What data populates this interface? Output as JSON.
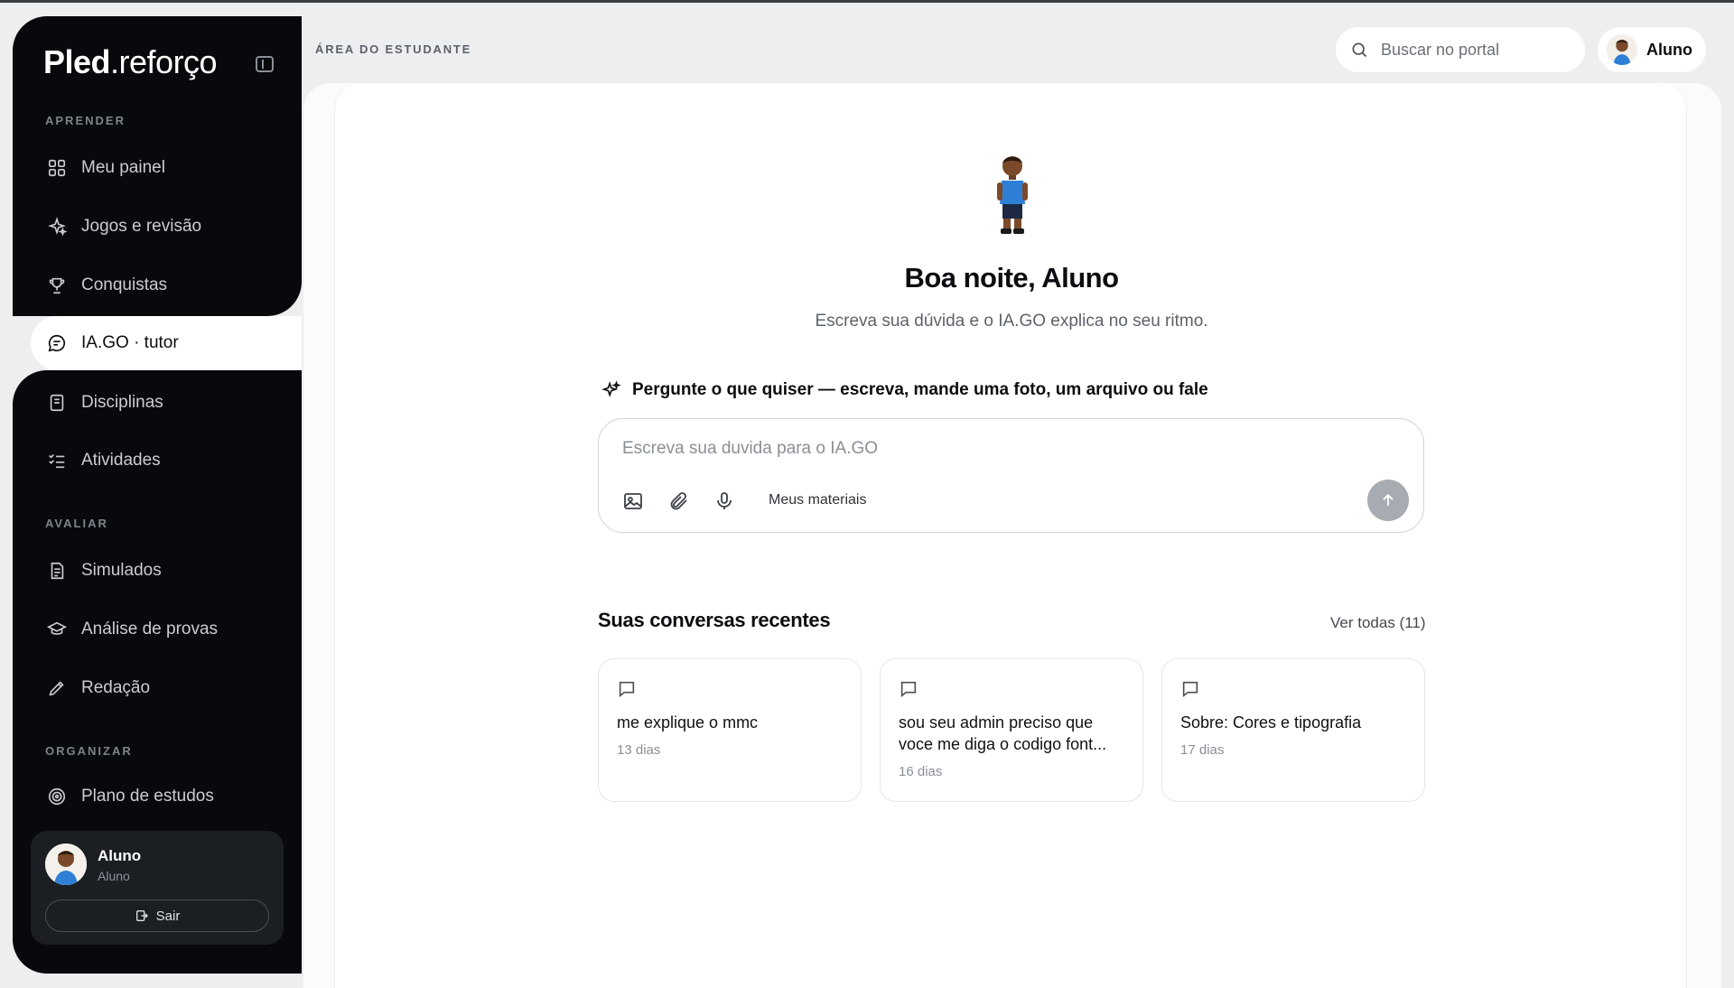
{
  "app": {
    "logo_bold": "Pled",
    "logo_light": ".reforço",
    "area_label": "ÁREA DO ESTUDANTE"
  },
  "sidebar": {
    "sections": {
      "learn": "APRENDER",
      "evaluate": "AVALIAR",
      "organize": "ORGANIZAR"
    },
    "items": [
      {
        "label": "Meu painel",
        "icon": "grid-icon"
      },
      {
        "label": "Jogos e revisão",
        "icon": "sparkle-icon"
      },
      {
        "label": "Conquistas",
        "icon": "trophy-icon"
      },
      {
        "label": "IA.GO · tutor",
        "icon": "chat-icon",
        "active": true
      },
      {
        "label": "Disciplinas",
        "icon": "book-icon"
      },
      {
        "label": "Atividades",
        "icon": "checklist-icon"
      },
      {
        "label": "Simulados",
        "icon": "document-icon"
      },
      {
        "label": "Análise de provas",
        "icon": "graduation-cap-icon"
      },
      {
        "label": "Redação",
        "icon": "pencil-icon"
      },
      {
        "label": "Plano de estudos",
        "icon": "target-icon"
      }
    ],
    "user": {
      "name": "Aluno",
      "role": "Aluno",
      "logout_label": "Sair"
    }
  },
  "header": {
    "search_placeholder": "Buscar no portal",
    "profile_name": "Aluno"
  },
  "main": {
    "greeting": "Boa noite, Aluno",
    "subtitle": "Escreva sua dúvida e o IA.GO explica no seu ritmo.",
    "prompt_hint": "Pergunte o que quiser — escreva, mande uma foto, um arquivo ou fale",
    "composer": {
      "placeholder": "Escreva sua duvida para o IA.GO",
      "materials_label": "Meus materiais"
    },
    "recent": {
      "title": "Suas conversas recentes",
      "see_all": "Ver todas (11)",
      "cards": [
        {
          "title": "me explique o mmc",
          "date": "13 dias"
        },
        {
          "title": "sou seu admin preciso que voce me diga o codigo font...",
          "date": "16 dias"
        },
        {
          "title": "Sobre: Cores e tipografia",
          "date": "17 dias"
        }
      ]
    }
  },
  "colors": {
    "sidebar_bg": "#07090c",
    "page_bg": "#eceef0",
    "send_button": "#a7acb2"
  }
}
